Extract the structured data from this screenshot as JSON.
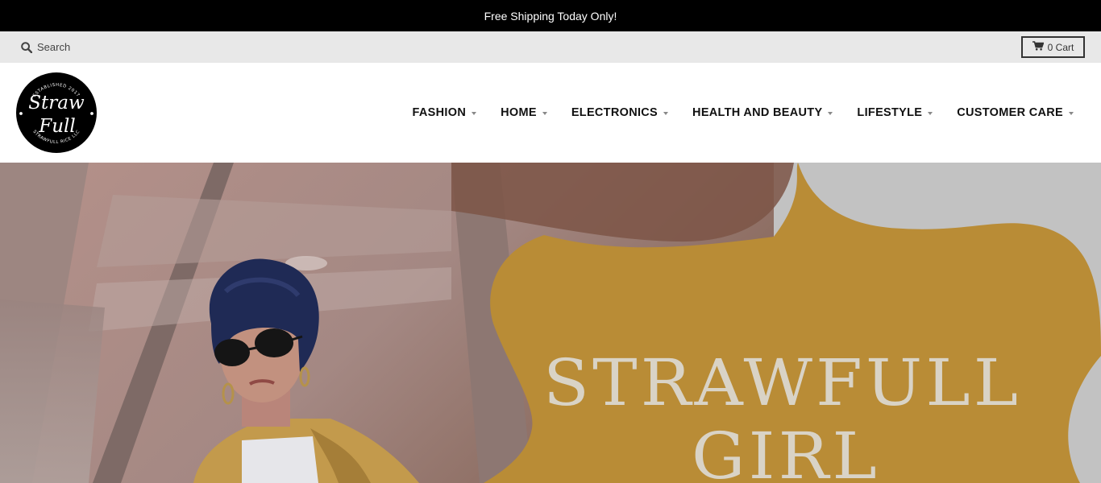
{
  "announcement": "Free Shipping Today Only!",
  "utility": {
    "search_label": "Search",
    "cart_label": "0 Cart"
  },
  "logo": {
    "top_text": "ESTABLISHED 2017",
    "line1": "Straw",
    "line2": "Full",
    "bottom_text": "STRAWFULL RICE LLC"
  },
  "nav": {
    "items": [
      {
        "label": "FASHION"
      },
      {
        "label": "HOME"
      },
      {
        "label": "ELECTRONICS"
      },
      {
        "label": "HEALTH AND BEAUTY"
      },
      {
        "label": "LIFESTYLE"
      },
      {
        "label": "CUSTOMER CARE"
      }
    ]
  },
  "hero": {
    "title_line1": "STRAWFULL",
    "title_line2": "GIRL"
  },
  "colors": {
    "announcement_bg": "#000000",
    "utility_bg": "#e8e8e8",
    "badge_gold": "#b98c36",
    "hero_wall": "#9c8580"
  }
}
